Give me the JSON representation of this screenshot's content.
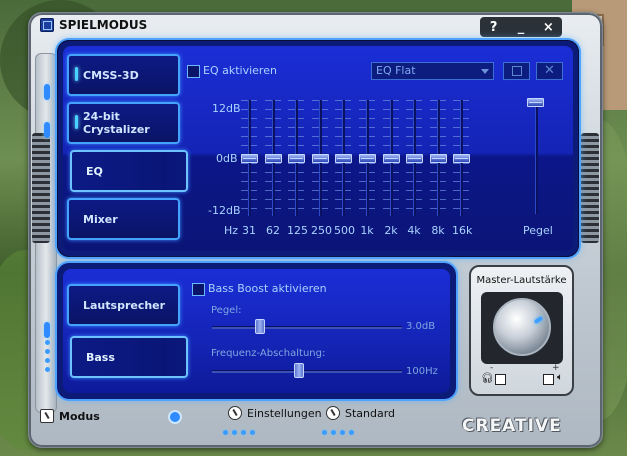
{
  "window": {
    "title": "SPIELMODUS",
    "buttons": {
      "help": "?",
      "minimize": "_",
      "close": "×"
    }
  },
  "nav_upper": [
    {
      "label": "CMSS-3D",
      "active": false
    },
    {
      "label": "24-bit Crystalizer",
      "active": false
    },
    {
      "label": "EQ",
      "active": true
    },
    {
      "label": "Mixer",
      "active": false
    }
  ],
  "eq": {
    "enable_label": "EQ aktivieren",
    "preset_value": "EQ Flat",
    "db_labels": {
      "top": "12dB",
      "mid": "0dB",
      "bottom": "-12dB"
    },
    "hz_label": "Hz",
    "bands": [
      "31",
      "62",
      "125",
      "250",
      "500",
      "1k",
      "2k",
      "4k",
      "8k",
      "16k"
    ],
    "band_gain_db": [
      0,
      0,
      0,
      0,
      0,
      0,
      0,
      0,
      0,
      0
    ],
    "level_label": "Pegel",
    "level_fraction": 1.0
  },
  "nav_lower": [
    {
      "label": "Lautsprecher",
      "active": false
    },
    {
      "label": "Bass",
      "active": true
    }
  ],
  "bass": {
    "boost_label": "Bass Boost aktivieren",
    "level_label": "Pegel:",
    "level_value": "3.0dB",
    "level_fraction": 0.25,
    "crossover_label": "Frequenz-Abschaltung:",
    "crossover_value": "100Hz",
    "crossover_fraction": 0.46
  },
  "master": {
    "title": "Master-Lautstärke",
    "minus": "-",
    "plus": "+"
  },
  "footer": {
    "mode_label": "Modus",
    "settings_label": "Einstellungen",
    "standard_label": "Standard",
    "brand": "CREATIVE"
  },
  "colors": {
    "accent": "#43a3ff",
    "panel": "#1424b5"
  }
}
